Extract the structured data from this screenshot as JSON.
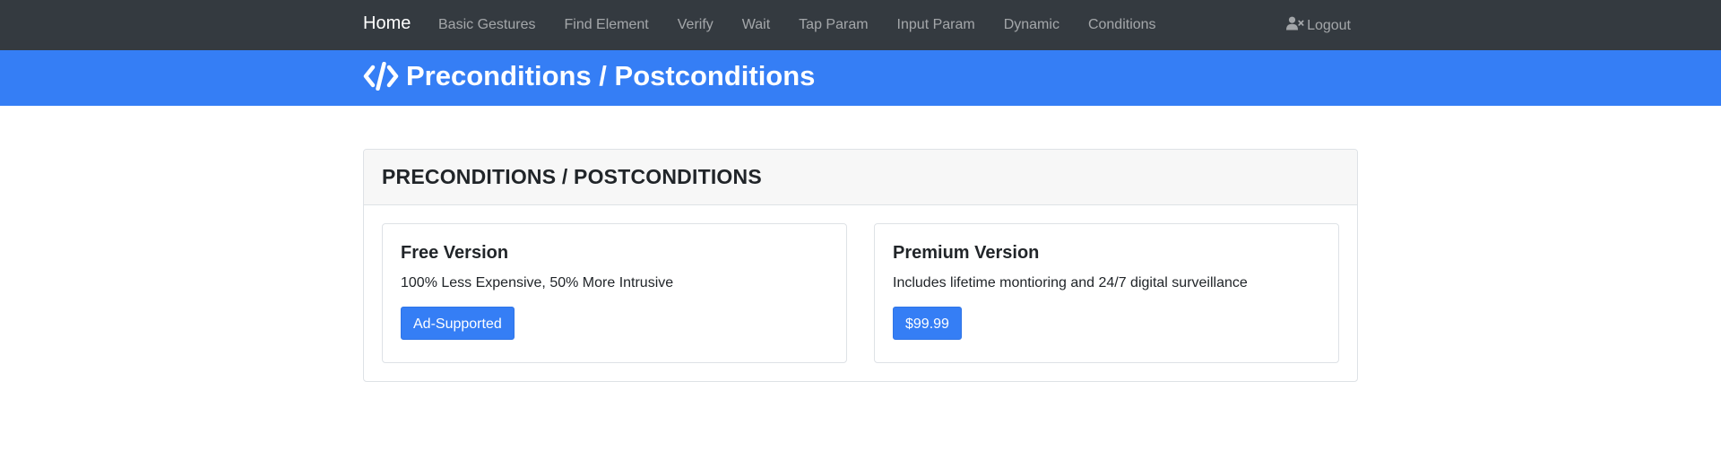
{
  "navbar": {
    "brand": "Home",
    "links": [
      "Basic Gestures",
      "Find Element",
      "Verify",
      "Wait",
      "Tap Param",
      "Input Param",
      "Dynamic",
      "Conditions"
    ],
    "logout_label": "Logout",
    "logout_icon": "user-times-icon"
  },
  "hero": {
    "icon": "code-icon",
    "title": "Preconditions / Postconditions"
  },
  "card": {
    "header": "PRECONDITIONS / POSTCONDITIONS",
    "free": {
      "title": "Free Version",
      "text": "100% Less Expensive, 50% More Intrusive",
      "button": "Ad-Supported"
    },
    "premium": {
      "title": "Premium Version",
      "text": "Includes lifetime montioring and 24/7 digital surveillance",
      "button": "$99.99"
    }
  },
  "colors": {
    "navbar_bg": "#343a40",
    "hero_bg": "#357ef5",
    "button_bg": "#357ef5"
  }
}
